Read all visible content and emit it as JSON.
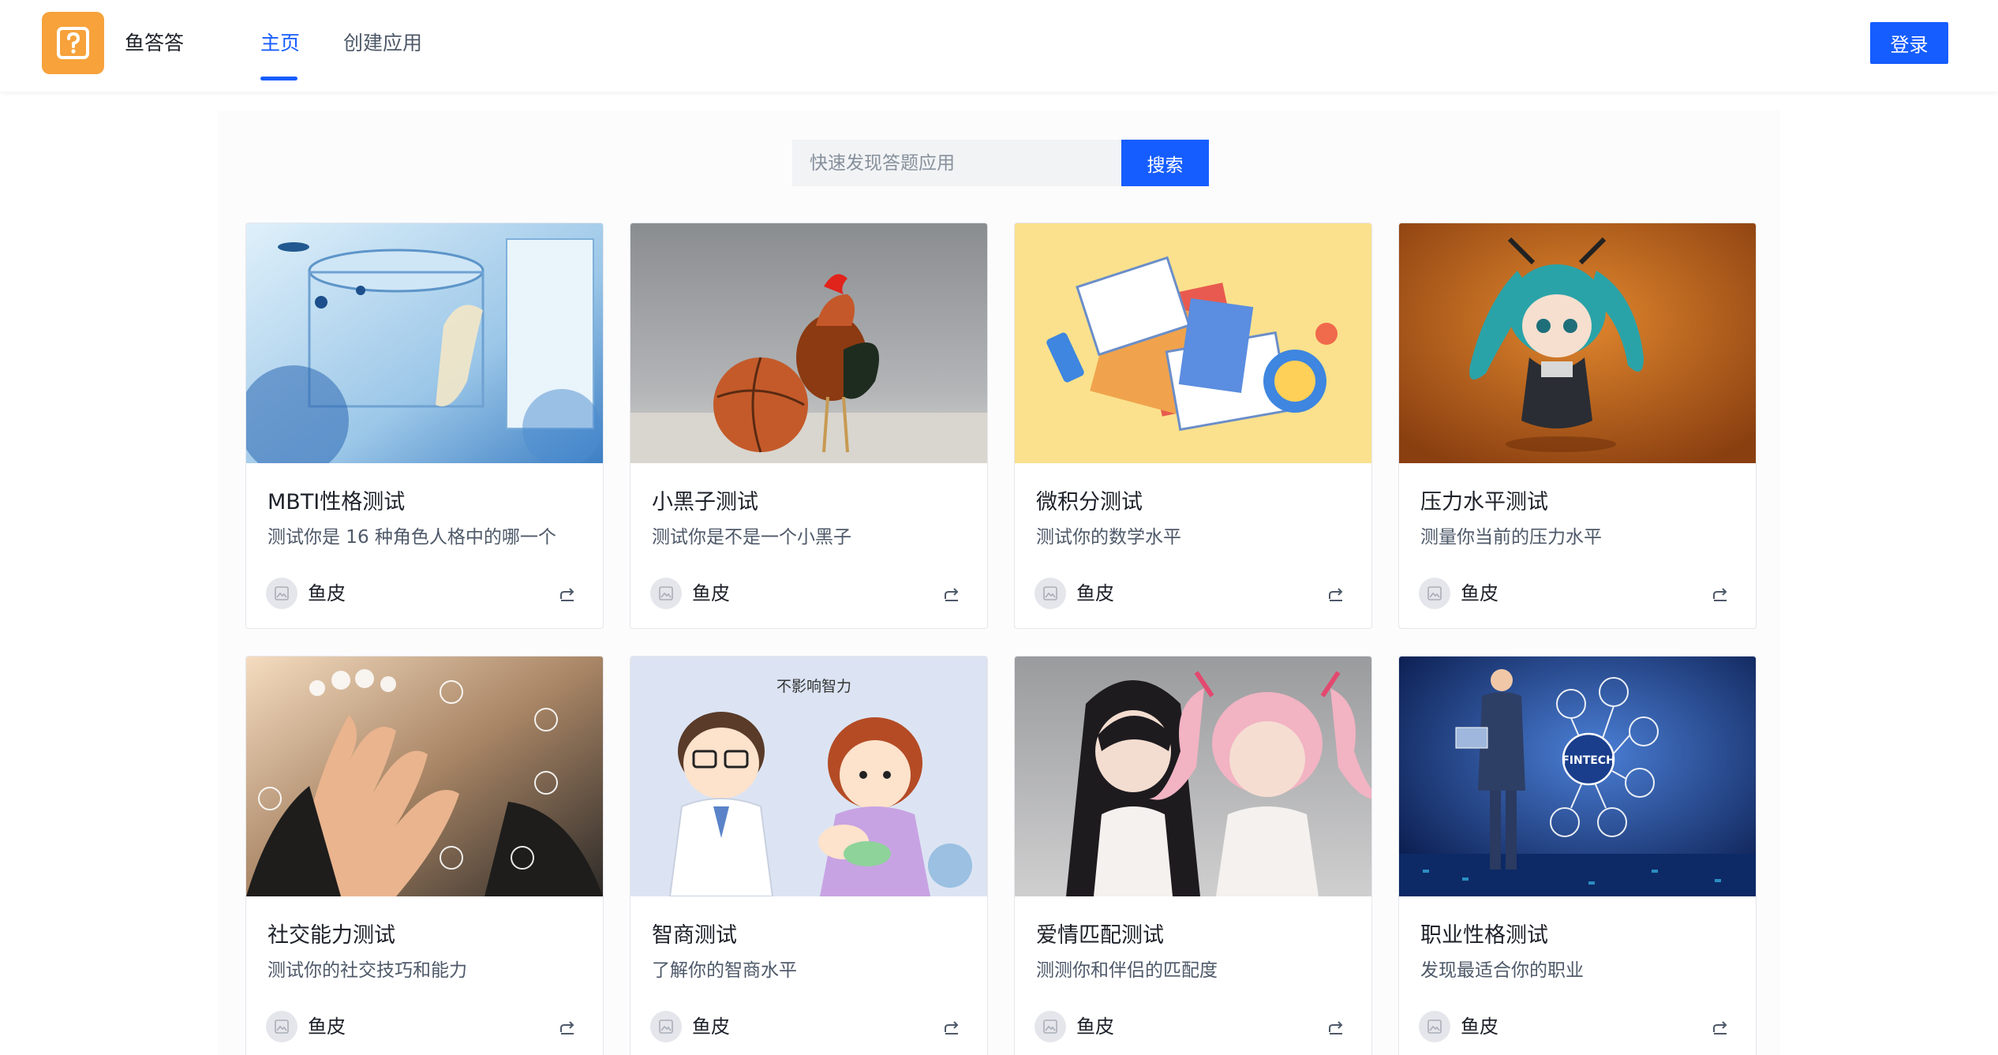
{
  "header": {
    "app_name": "鱼答答",
    "nav": [
      {
        "label": "主页",
        "active": true
      },
      {
        "label": "创建应用",
        "active": false
      }
    ],
    "login_label": "登录",
    "accent_color": "#165dff",
    "logo_color": "#f7a23b"
  },
  "search": {
    "placeholder": "快速发现答题应用",
    "button_label": "搜索"
  },
  "cards": [
    {
      "title": "MBTI性格测试",
      "description": "测试你是 16 种角色人格中的哪一个",
      "author": "鱼皮",
      "cover": "illustrated-underwater-room"
    },
    {
      "title": "小黑子测试",
      "description": "测试你是不是一个小黑子",
      "author": "鱼皮",
      "cover": "rooster-with-basketball"
    },
    {
      "title": "微积分测试",
      "description": "测试你的数学水平",
      "author": "鱼皮",
      "cover": "books-and-study-items"
    },
    {
      "title": "压力水平测试",
      "description": "测量你当前的压力水平",
      "author": "鱼皮",
      "cover": "teal-haired-figure"
    },
    {
      "title": "社交能力测试",
      "description": "测试你的社交技巧和能力",
      "author": "鱼皮",
      "cover": "raised-hands-network"
    },
    {
      "title": "智商测试",
      "description": "了解你的智商水平",
      "author": "鱼皮",
      "cover": "doctor-and-mother-cartoon"
    },
    {
      "title": "爱情匹配测试",
      "description": "测测你和伴侣的匹配度",
      "author": "鱼皮",
      "cover": "two-anime-figures"
    },
    {
      "title": "职业性格测试",
      "description": "发现最适合你的职业",
      "author": "鱼皮",
      "cover": "businessman-fintech"
    }
  ],
  "cover_illustration_text": {
    "iq_bubble": "不影响智力",
    "fintech_hub": "FINTECH"
  }
}
